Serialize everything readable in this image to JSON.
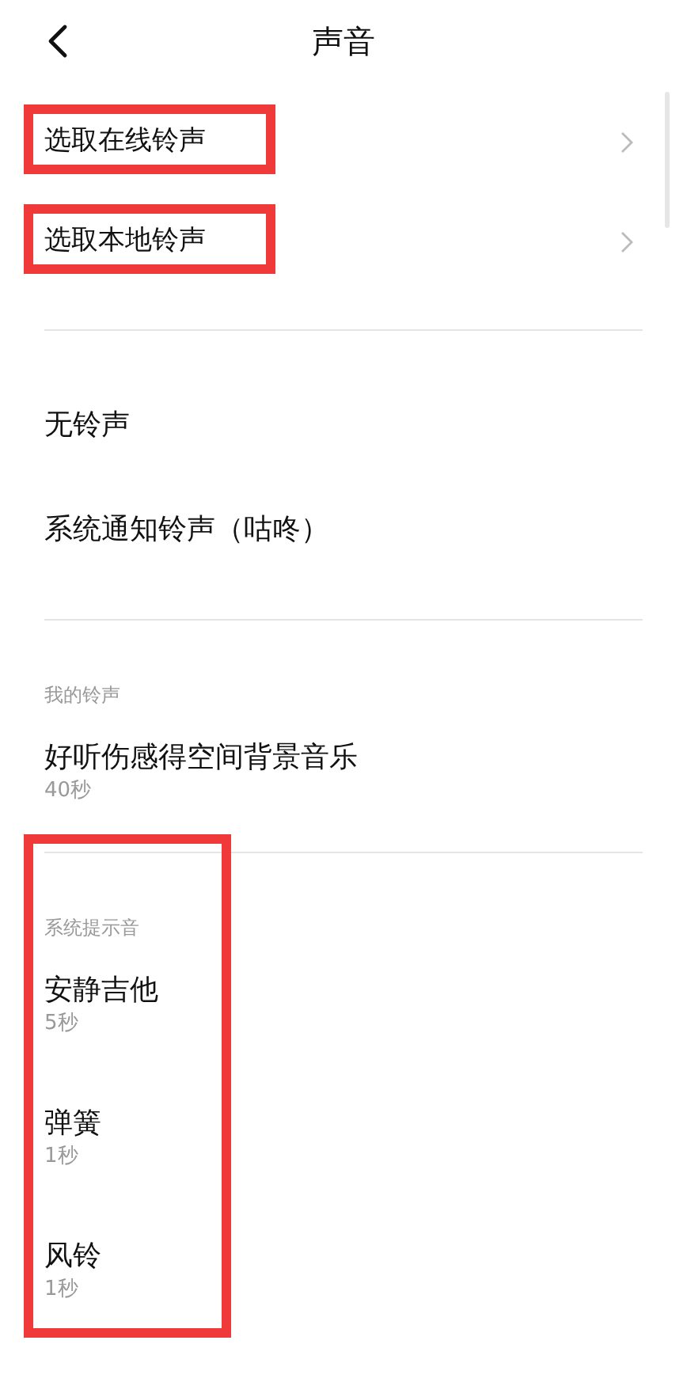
{
  "header": {
    "title": "声音"
  },
  "pickers": [
    {
      "label": "选取在线铃声",
      "highlighted": true
    },
    {
      "label": "选取本地铃声",
      "highlighted": true
    }
  ],
  "options": [
    {
      "label": "无铃声"
    },
    {
      "label": "系统通知铃声（咕咚）"
    }
  ],
  "my_ringtones": {
    "heading": "我的铃声",
    "items": [
      {
        "title": "好听伤感得空间背景音乐",
        "duration": "40秒"
      }
    ]
  },
  "system_sounds": {
    "heading": "系统提示音",
    "highlighted": true,
    "items": [
      {
        "title": "安静吉他",
        "duration": "5秒"
      },
      {
        "title": "弹簧",
        "duration": "1秒"
      },
      {
        "title": "风铃",
        "duration": "1秒"
      }
    ]
  }
}
